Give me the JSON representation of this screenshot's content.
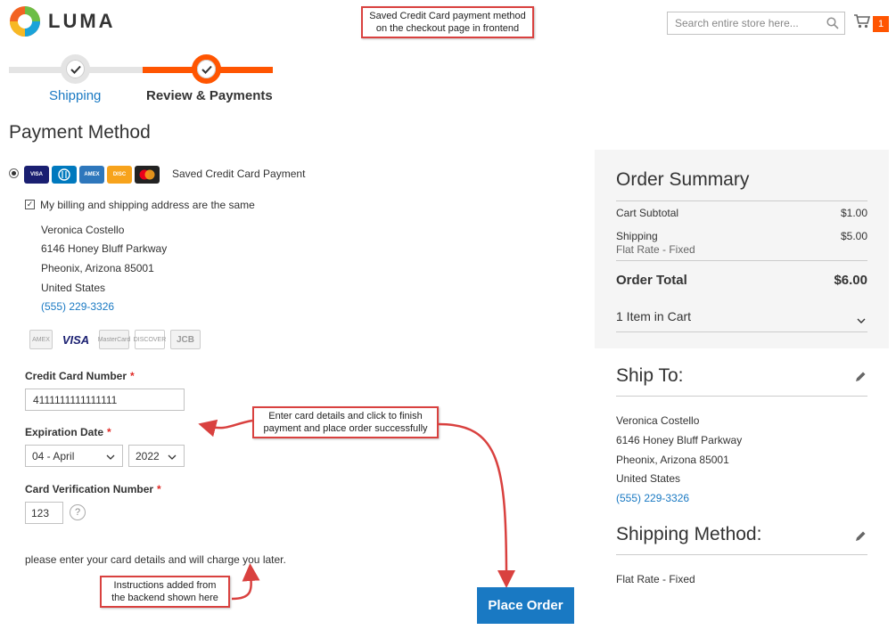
{
  "header": {
    "logo_text": "LUMA",
    "search_placeholder": "Search entire store here...",
    "cart_count": "1",
    "brand_accent": "#ff5501",
    "link_color": "#1979c3"
  },
  "annotations": {
    "top_note_1": "Saved Credit Card payment method",
    "top_note_2": "on the checkout page in frontend",
    "mid_note_1": "Enter card details and click to finish",
    "mid_note_2": "payment and place order successfully",
    "bottom_note_1": "Instructions added from",
    "bottom_note_2": "the backend shown here"
  },
  "progress": {
    "step1_label": "Shipping",
    "step2_label": "Review & Payments"
  },
  "payment": {
    "title": "Payment Method",
    "method_label": "Saved Credit Card Payment",
    "method_card_icons": [
      "visa-icon",
      "diners-icon",
      "amex-icon",
      "discover-icon",
      "mastercard-icon"
    ],
    "billing_same_label": "My billing and shipping address are the same",
    "billing_address": {
      "name": "Veronica Costello",
      "street": "6146 Honey Bluff Parkway",
      "city": "Pheonix, Arizona 85001",
      "country": "United States",
      "phone": "(555) 229-3326"
    },
    "accepted_cards": [
      "AMEX",
      "VISA",
      "MasterCard",
      "DISCOVER",
      "JCB"
    ],
    "cc_number_label": "Credit Card Number",
    "cc_number_value": "4111111111111111",
    "exp_label": "Expiration Date",
    "exp_month": "04 - April",
    "exp_year": "2022",
    "cvv_label": "Card Verification Number",
    "cvv_value": "123",
    "help_glyph": "?",
    "required_mark": "*",
    "instructions": "please enter your card details and will charge you later.",
    "place_order": "Place Order"
  },
  "summary": {
    "title": "Order Summary",
    "subtotal_label": "Cart Subtotal",
    "subtotal_value": "$1.00",
    "shipping_label": "Shipping",
    "shipping_method": "Flat Rate - Fixed",
    "shipping_value": "$5.00",
    "total_label": "Order Total",
    "total_value": "$6.00",
    "items_label": "1 Item in Cart"
  },
  "ship_to": {
    "title": "Ship To:",
    "name": "Veronica Costello",
    "street": "6146 Honey Bluff Parkway",
    "city": "Pheonix, Arizona 85001",
    "country": "United States",
    "phone": "(555) 229-3326"
  },
  "shipping_method": {
    "title": "Shipping Method:",
    "value": "Flat Rate - Fixed"
  }
}
